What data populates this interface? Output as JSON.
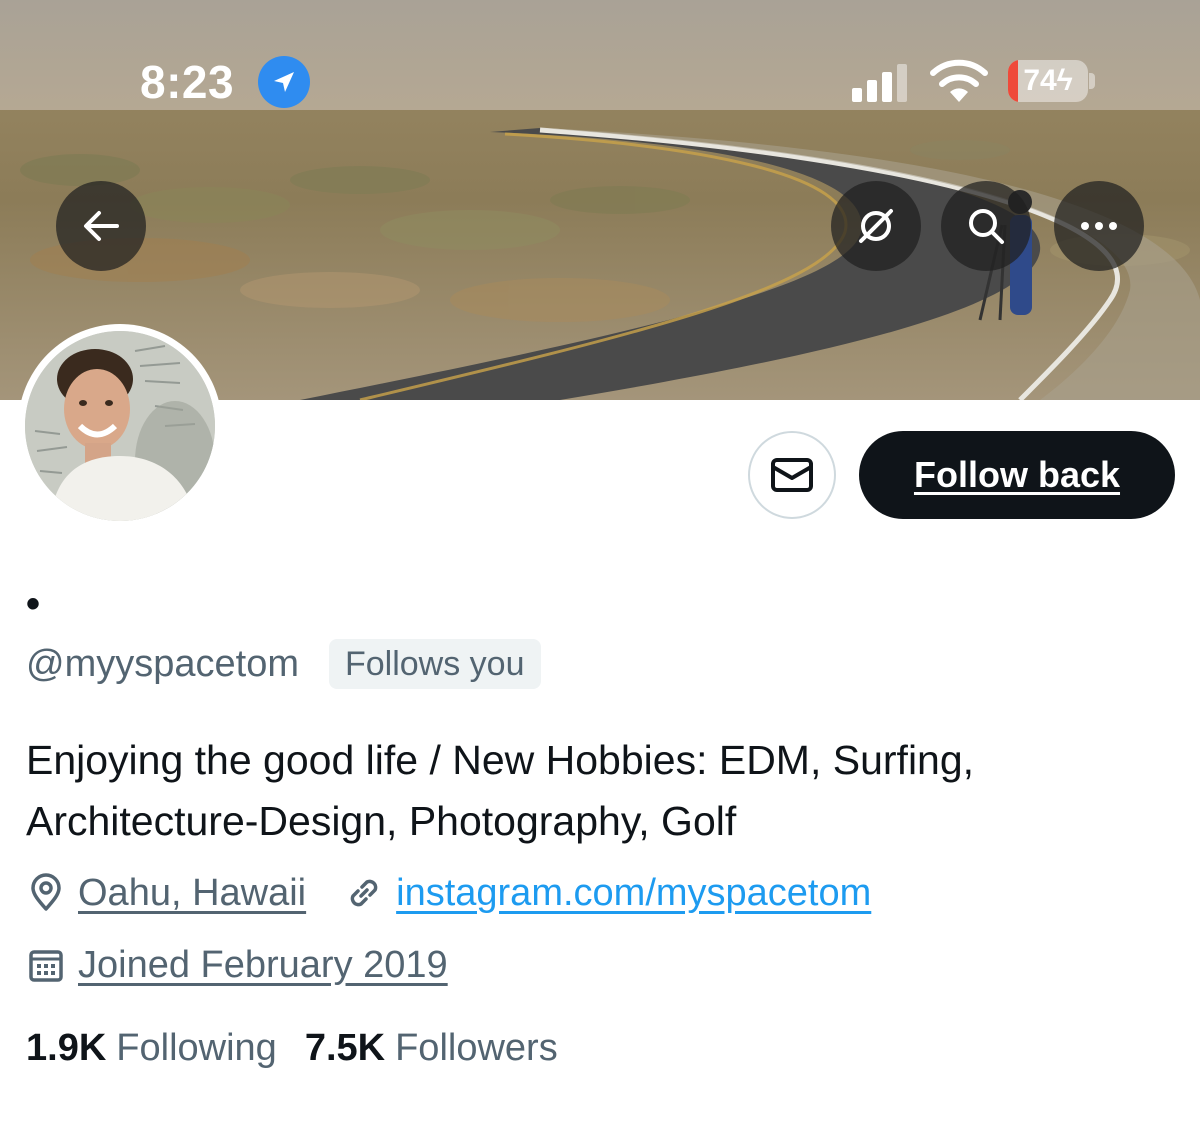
{
  "status_bar": {
    "time": "8:23",
    "battery": "74",
    "icons": [
      "location-arrow-icon",
      "cellular-signal-icon",
      "wifi-icon",
      "battery-charging-icon"
    ]
  },
  "banner": {
    "buttons": [
      "back-arrow-icon",
      "grok-icon",
      "search-icon",
      "more-icon"
    ]
  },
  "actions": {
    "message_icon": "envelope-icon",
    "follow_label": "Follow back"
  },
  "profile": {
    "display_name": "•",
    "handle": "@myyspacetom",
    "follows_you": "Follows you",
    "bio": "Enjoying the good life / New Hobbies: EDM, Surfing, Architecture-Design, Photography, Golf",
    "location": "Oahu, Hawaii",
    "website": "instagram.com/myspacetom",
    "joined": "Joined February 2019",
    "following_count": "1.9K",
    "following_label": "Following",
    "followers_count": "7.5K",
    "followers_label": "Followers"
  },
  "colors": {
    "accent": "#1d9bf0",
    "text_primary": "#0f1419",
    "text_secondary": "#536471",
    "location_badge": "#2f8cf0"
  }
}
